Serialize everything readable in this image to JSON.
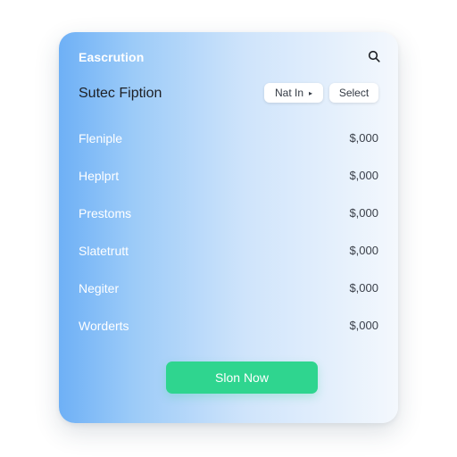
{
  "header": {
    "brand": "Eascrution",
    "search_icon": "search-icon"
  },
  "section": {
    "title": "Sutec Fiption",
    "net_label": "Nat In",
    "select_label": "Select"
  },
  "items": [
    {
      "label": "Fleniple",
      "value": "$,000"
    },
    {
      "label": "Heplprt",
      "value": "$,000"
    },
    {
      "label": "Prestoms",
      "value": "$,000"
    },
    {
      "label": "Slatetrutt",
      "value": "$,000"
    },
    {
      "label": "Negiter",
      "value": "$,000"
    },
    {
      "label": "Worderts",
      "value": "$,000"
    }
  ],
  "cta": {
    "label": "Slon Now"
  },
  "colors": {
    "accent": "#2fd58f",
    "gradient_start": "#6eb0f6",
    "gradient_end": "#f4f8fd"
  }
}
